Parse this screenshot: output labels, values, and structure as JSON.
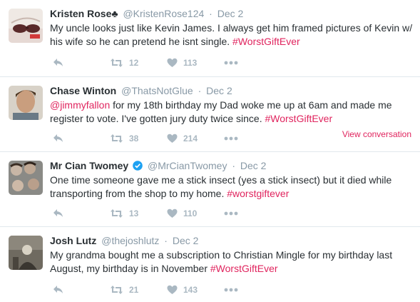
{
  "tweets": [
    {
      "name": "Kristen Rose♣",
      "handle": "@KristenRose124",
      "separator": "·",
      "date": "Dec 2",
      "text_parts": [
        "My uncle looks just like Kevin James. I always get him framed pictures of Kevin w/ his wife so he can pretend he isnt single. "
      ],
      "hashtag": "#WorstGiftEver",
      "retweets": "12",
      "likes": "113"
    },
    {
      "name": "Chase Winton",
      "handle": "@ThatsNotGlue",
      "separator": "·",
      "date": "Dec 2",
      "mention": "@jimmyfallon",
      "text_parts": [
        " for my 18th birthday my Dad woke me up at 6am and made me register to vote. I've gotten jury duty twice since. "
      ],
      "hashtag": "#WorstGiftEver",
      "retweets": "38",
      "likes": "214",
      "view_conversation": "View conversation"
    },
    {
      "name": "Mr Cian Twomey",
      "handle": "@MrCianTwomey",
      "separator": "·",
      "date": "Dec 2",
      "text_parts": [
        "One time someone gave me a stick insect (yes a stick insect) but it died while transporting from the shop to my home. "
      ],
      "hashtag": "#worstgiftever",
      "retweets": "13",
      "likes": "110"
    },
    {
      "name": "Josh Lutz",
      "handle": "@thejoshlutz",
      "separator": "·",
      "date": "Dec 2",
      "text_parts": [
        "My grandma bought me a subscription to Christian Mingle for my birthday last August, my birthday is in November "
      ],
      "hashtag": "#WorstGiftEver",
      "retweets": "21",
      "likes": "143"
    }
  ],
  "colors": {
    "accent": "#e0245e",
    "muted": "#8899a6",
    "icon": "#aab8c2",
    "verified": "#1da1f2"
  },
  "icons": {
    "reply": "reply-icon",
    "retweet": "retweet-icon",
    "like": "heart-icon",
    "more": "more-icon",
    "verified": "verified-badge-icon"
  }
}
